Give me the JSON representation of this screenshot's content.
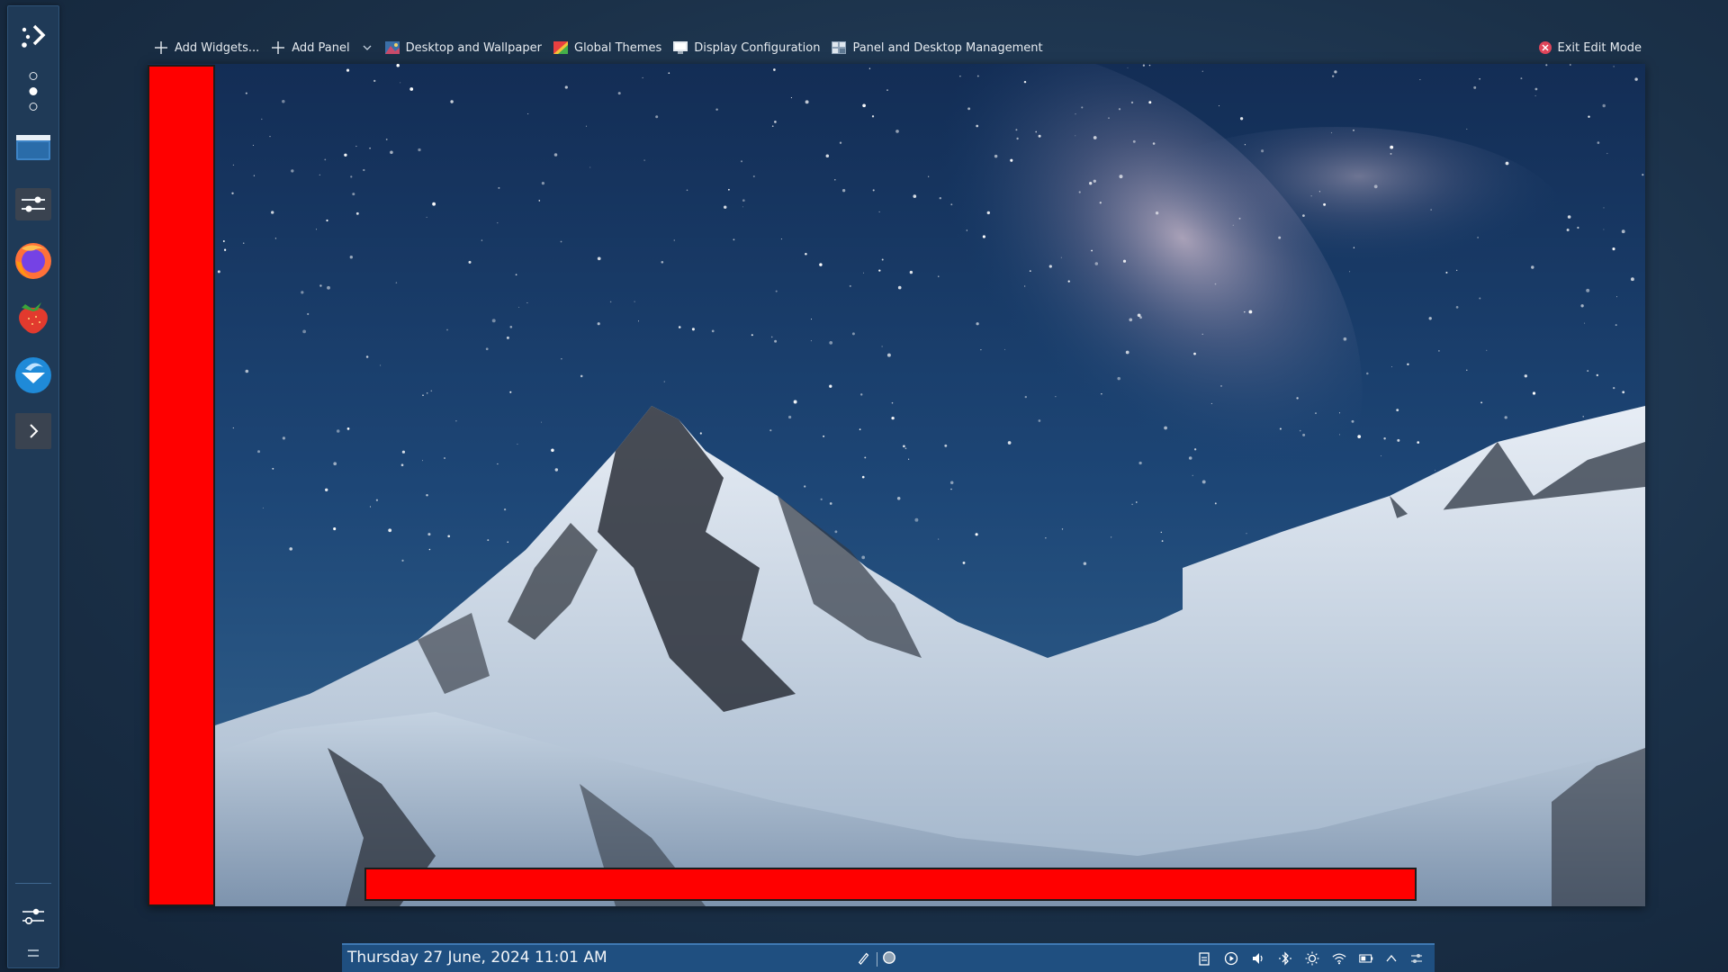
{
  "toolbar": {
    "add_widgets_label": "Add Widgets...",
    "add_panel_label": "Add Panel",
    "desktop_wallpaper_label": "Desktop and Wallpaper",
    "global_themes_label": "Global Themes",
    "display_config_label": "Display Configuration",
    "panel_management_label": "Panel and Desktop Management",
    "exit_edit_label": "Exit Edit Mode"
  },
  "left_panel": {
    "icons": [
      "kickoff-launcher-icon",
      "pager-icon",
      "file-manager-icon",
      "settings-icon",
      "firefox-icon",
      "strawberry-icon",
      "thunderbird-icon",
      "expand-arrow-icon",
      "panel-config-icon",
      "panel-resize-icon"
    ]
  },
  "taskbar": {
    "clock": "Thursday 27 June, 2024 11:01 AM",
    "tray_icons": [
      "clipboard-icon",
      "media-player-icon",
      "volume-icon",
      "bluetooth-icon",
      "brightness-icon",
      "wifi-icon",
      "battery-icon",
      "tray-expand-icon",
      "panel-config-icon"
    ]
  },
  "colors": {
    "panel_bg": "#1f3a57",
    "taskbar_bg": "#1f4f80",
    "highlight": "#ff0000",
    "exit_icon": "#e0455a"
  }
}
